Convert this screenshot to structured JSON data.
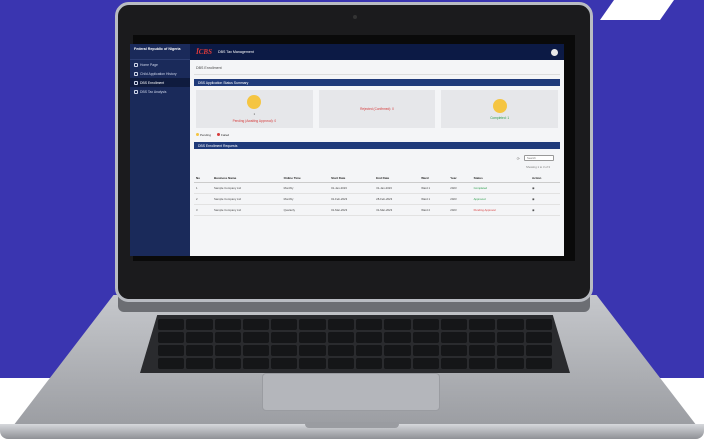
{
  "sidebar": {
    "brand": "Federal Republic of Nigeria",
    "items": [
      {
        "label": "Home Page",
        "icon": "home-icon",
        "active": false
      },
      {
        "label": "Child Application History",
        "icon": "history-icon",
        "active": false
      },
      {
        "label": "DBS Enrollment",
        "icon": "enroll-icon",
        "active": true
      },
      {
        "label": "DBS Tax Analysis",
        "icon": "analysis-icon",
        "active": false
      }
    ]
  },
  "topbar": {
    "logo_main": "ĪC",
    "logo_accent": "BS",
    "app_name": "DBS Tax Management"
  },
  "page": {
    "title": "DBS Enrollment",
    "summary_section": "DBS Application Status Summary",
    "cards": [
      {
        "value": "1",
        "label": "Pending (Awaiting Approval): 0",
        "tone": "red"
      },
      {
        "value": "",
        "label": "Rejected (Confirmed): 0",
        "tone": "red"
      },
      {
        "value": "",
        "label": "Completed: 1",
        "tone": "green"
      }
    ],
    "legend": [
      {
        "label": "Pending",
        "color": "#f5c542"
      },
      {
        "label": "Failed",
        "color": "#d63b3b"
      }
    ],
    "requests_section": "DBS Enrollment Requests",
    "search_placeholder": "Search",
    "filter_label": "Showing 1 to 3 of 3"
  },
  "table": {
    "headers": [
      "No",
      "Business Name",
      "Online Time",
      "Start Date",
      "End Date",
      "Ward",
      "Year",
      "Status",
      "Action"
    ],
    "rows": [
      {
        "no": "1",
        "name": "Sample Company Ltd",
        "time": "Monthly",
        "start": "01-Jan-2023",
        "end": "31-Jan-2023",
        "ward": "Ward 1",
        "year": "2023",
        "status": "Completed",
        "tone": "green",
        "action": "view"
      },
      {
        "no": "2",
        "name": "Sample Company Ltd",
        "time": "Monthly",
        "start": "01-Feb-2023",
        "end": "28-Feb-2023",
        "ward": "Ward 1",
        "year": "2023",
        "status": "Approved",
        "tone": "green",
        "action": "view"
      },
      {
        "no": "3",
        "name": "Sample Company Ltd",
        "time": "Quarterly",
        "start": "01-Mar-2023",
        "end": "31-Mar-2023",
        "ward": "Ward 2",
        "year": "2023",
        "status": "Pending Approval",
        "tone": "red",
        "action": "view"
      }
    ]
  }
}
